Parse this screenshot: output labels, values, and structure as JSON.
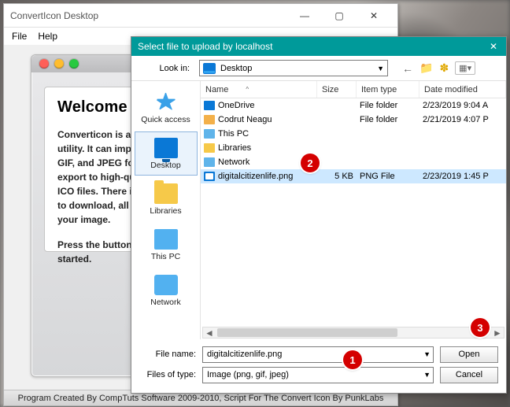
{
  "app": {
    "title": "ConvertIcon Desktop",
    "menus": [
      "File",
      "Help"
    ],
    "welcome": {
      "heading": "Welcome",
      "para1": "Converticon is a simple icon utility. It can import ICO, PNG, GIF, and JPEG formats and export to high-quality PNG or ICO files. There is no software to download, all you need is your image.",
      "para2": "Press the button below to get started."
    },
    "footer": "Program Created By CompTuts Software 2009-2010, Script For The Convert Icon By PunkLabs"
  },
  "dialog": {
    "title": "Select file to upload by localhost",
    "lookInLabel": "Look in:",
    "lookInValue": "Desktop",
    "places": [
      {
        "name": "Quick access",
        "icon": "star"
      },
      {
        "name": "Desktop",
        "icon": "monitor"
      },
      {
        "name": "Libraries",
        "icon": "folder"
      },
      {
        "name": "This PC",
        "icon": "pc"
      },
      {
        "name": "Network",
        "icon": "net"
      }
    ],
    "columns": {
      "name": "Name",
      "size": "Size",
      "type": "Item type",
      "date": "Date modified"
    },
    "files": [
      {
        "icon": "onedrive",
        "name": "OneDrive",
        "size": "",
        "type": "File folder",
        "date": "2/23/2019 9:04 A"
      },
      {
        "icon": "user",
        "name": "Codrut Neagu",
        "size": "",
        "type": "File folder",
        "date": "2/21/2019 4:07 P"
      },
      {
        "icon": "pc",
        "name": "This PC",
        "size": "",
        "type": "",
        "date": ""
      },
      {
        "icon": "lib",
        "name": "Libraries",
        "size": "",
        "type": "",
        "date": ""
      },
      {
        "icon": "net",
        "name": "Network",
        "size": "",
        "type": "",
        "date": ""
      },
      {
        "icon": "png",
        "name": "digitalcitizenlife.png",
        "size": "5 KB",
        "type": "PNG File",
        "date": "2/23/2019 1:45 P",
        "selected": true
      }
    ],
    "fileNameLabel": "File name:",
    "fileNameValue": "digitalcitizenlife.png",
    "fileTypeLabel": "Files of type:",
    "fileTypeValue": "Image (png, gif, jpeg)",
    "openLabel": "Open",
    "cancelLabel": "Cancel"
  },
  "markers": {
    "m1": "1",
    "m2": "2",
    "m3": "3"
  }
}
